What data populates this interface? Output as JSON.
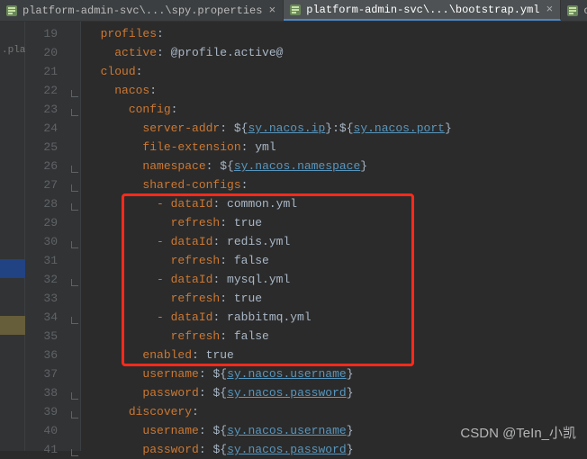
{
  "tabs": [
    {
      "label": "platform-admin-svc\\...\\spy.properties",
      "active": false
    },
    {
      "label": "platform-admin-svc\\...\\bootstrap.yml",
      "active": true
    },
    {
      "label": "config-qas",
      "active": false
    }
  ],
  "leftGutterText": ".platf",
  "watermark": "CSDN @TeIn_小凯",
  "lineStart": 19,
  "lines": [
    {
      "n": 19,
      "ind": 1,
      "seg": [
        [
          "key",
          "profiles"
        ],
        [
          "p",
          ":"
        ]
      ]
    },
    {
      "n": 20,
      "ind": 2,
      "seg": [
        [
          "key",
          "active"
        ],
        [
          "p",
          ": "
        ],
        [
          "at",
          "@profile.active@"
        ]
      ]
    },
    {
      "n": 21,
      "ind": 1,
      "seg": [
        [
          "key",
          "cloud"
        ],
        [
          "p",
          ":"
        ]
      ]
    },
    {
      "n": 22,
      "ind": 2,
      "seg": [
        [
          "key",
          "nacos"
        ],
        [
          "p",
          ":"
        ]
      ]
    },
    {
      "n": 23,
      "ind": 3,
      "seg": [
        [
          "key",
          "config"
        ],
        [
          "p",
          ":"
        ]
      ]
    },
    {
      "n": 24,
      "ind": 4,
      "seg": [
        [
          "key",
          "server-addr"
        ],
        [
          "p",
          ": ${"
        ],
        [
          "link",
          "sy.nacos.ip"
        ],
        [
          "p",
          "}:${"
        ],
        [
          "link",
          "sy.nacos.port"
        ],
        [
          "p",
          "}"
        ]
      ]
    },
    {
      "n": 25,
      "ind": 4,
      "seg": [
        [
          "key",
          "file-extension"
        ],
        [
          "p",
          ": yml"
        ]
      ]
    },
    {
      "n": 26,
      "ind": 4,
      "seg": [
        [
          "key",
          "namespace"
        ],
        [
          "p",
          ": ${"
        ],
        [
          "link",
          "sy.nacos.namespace"
        ],
        [
          "p",
          "}"
        ]
      ]
    },
    {
      "n": 27,
      "ind": 4,
      "seg": [
        [
          "key",
          "shared-configs"
        ],
        [
          "p",
          ":"
        ]
      ]
    },
    {
      "n": 28,
      "ind": 5,
      "seg": [
        [
          "dash",
          "- "
        ],
        [
          "key",
          "dataId"
        ],
        [
          "p",
          ": common.yml"
        ]
      ]
    },
    {
      "n": 29,
      "ind": 6,
      "seg": [
        [
          "key",
          "refresh"
        ],
        [
          "p",
          ": "
        ],
        [
          "bool",
          "true"
        ]
      ]
    },
    {
      "n": 30,
      "ind": 5,
      "seg": [
        [
          "dash",
          "- "
        ],
        [
          "key",
          "dataId"
        ],
        [
          "p",
          ": redis.yml"
        ]
      ]
    },
    {
      "n": 31,
      "ind": 6,
      "seg": [
        [
          "key",
          "refresh"
        ],
        [
          "p",
          ": "
        ],
        [
          "bool",
          "false"
        ]
      ]
    },
    {
      "n": 32,
      "ind": 5,
      "seg": [
        [
          "dash",
          "- "
        ],
        [
          "key",
          "dataId"
        ],
        [
          "p",
          ": mysql.yml"
        ]
      ]
    },
    {
      "n": 33,
      "ind": 6,
      "seg": [
        [
          "key",
          "refresh"
        ],
        [
          "p",
          ": "
        ],
        [
          "bool",
          "true"
        ]
      ]
    },
    {
      "n": 34,
      "ind": 5,
      "seg": [
        [
          "dash",
          "- "
        ],
        [
          "key",
          "dataId"
        ],
        [
          "p",
          ": rabbitmq.yml"
        ]
      ]
    },
    {
      "n": 35,
      "ind": 6,
      "seg": [
        [
          "key",
          "refresh"
        ],
        [
          "p",
          ": "
        ],
        [
          "bool",
          "false"
        ]
      ]
    },
    {
      "n": 36,
      "ind": 4,
      "seg": [
        [
          "key",
          "enabled"
        ],
        [
          "p",
          ": "
        ],
        [
          "bool",
          "true"
        ]
      ]
    },
    {
      "n": 37,
      "ind": 4,
      "seg": [
        [
          "key",
          "username"
        ],
        [
          "p",
          ": ${"
        ],
        [
          "link",
          "sy.nacos.username"
        ],
        [
          "p",
          "}"
        ]
      ]
    },
    {
      "n": 38,
      "ind": 4,
      "seg": [
        [
          "key",
          "password"
        ],
        [
          "p",
          ": ${"
        ],
        [
          "link",
          "sy.nacos.password"
        ],
        [
          "p",
          "}"
        ]
      ]
    },
    {
      "n": 39,
      "ind": 3,
      "seg": [
        [
          "key",
          "discovery"
        ],
        [
          "p",
          ":"
        ]
      ]
    },
    {
      "n": 40,
      "ind": 4,
      "seg": [
        [
          "key",
          "username"
        ],
        [
          "p",
          ": ${"
        ],
        [
          "link",
          "sy.nacos.username"
        ],
        [
          "p",
          "}"
        ]
      ]
    },
    {
      "n": 41,
      "ind": 4,
      "seg": [
        [
          "key",
          "password"
        ],
        [
          "p",
          ": ${"
        ],
        [
          "link",
          "sy.nacos.password"
        ],
        [
          "p",
          "}"
        ]
      ]
    }
  ],
  "foldMarks": [
    22,
    23,
    26,
    27,
    28,
    30,
    32,
    34,
    38,
    39,
    41
  ]
}
